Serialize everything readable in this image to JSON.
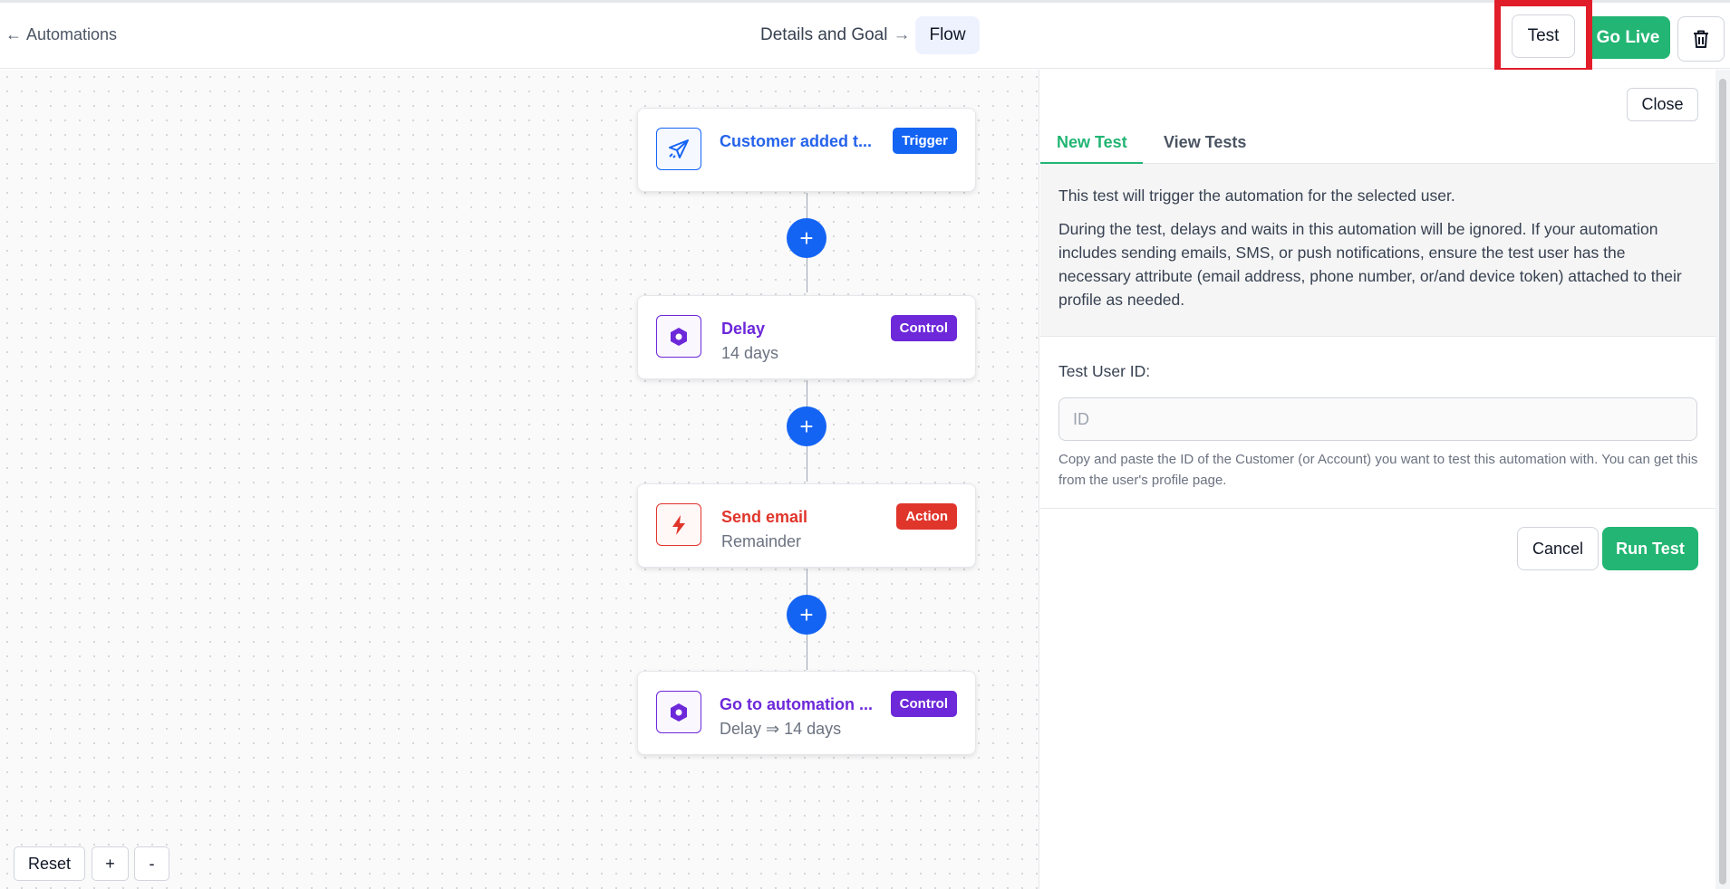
{
  "header": {
    "back_arrow": "←",
    "back_label": "Automations",
    "crumb_step1": "Details and Goal",
    "crumb_separator": "→",
    "crumb_step2": "Flow",
    "test_label": "Test",
    "golive_label": "Go Live",
    "delete_icon": "trash-icon"
  },
  "flow": {
    "nodes": [
      {
        "title": "Customer added t...",
        "subtitle": "",
        "badge": "Trigger",
        "icon": "paper-plane-icon",
        "color": "#2563eb"
      },
      {
        "title": "Delay",
        "subtitle": "14 days",
        "badge": "Control",
        "icon": "hexagon-icon",
        "color": "#6d28d9"
      },
      {
        "title": "Send email",
        "subtitle": "Remainder",
        "badge": "Action",
        "icon": "lightning-icon",
        "color": "#e0352b"
      },
      {
        "title": "Go to automation ...",
        "subtitle": "Delay ⇒ 14 days",
        "badge": "Control",
        "icon": "hexagon-icon",
        "color": "#6d28d9"
      }
    ],
    "add_step_label": "+"
  },
  "zoom": {
    "reset": "Reset",
    "plus": "+",
    "minus": "-"
  },
  "panel": {
    "close_label": "Close",
    "tabs": [
      {
        "label": "New Test",
        "active": true
      },
      {
        "label": "View Tests",
        "active": false
      }
    ],
    "info_line1": "This test will trigger the automation for the selected user.",
    "info_line2": "During the test, delays and waits in this automation will be ignored. If your automation includes sending emails, SMS, or push notifications, ensure the test user has the necessary attribute (email address, phone number, or/and device token) attached to their profile as needed.",
    "field_label": "Test User ID:",
    "field_placeholder": "ID",
    "field_value": "",
    "help_text": "Copy and paste the ID of the Customer (or Account) you want to test this automation with. You can get this from the user's profile page.",
    "cancel_label": "Cancel",
    "run_label": "Run Test"
  },
  "colors": {
    "primary_green": "#22b573",
    "plus_blue": "#1464f4",
    "trigger_blue": "#1464f4",
    "control_purple": "#6d28d9",
    "action_red": "#e0352b",
    "highlight_red": "#e11d2a"
  }
}
